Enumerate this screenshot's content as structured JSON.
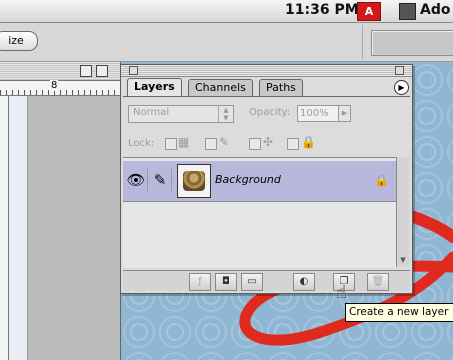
{
  "menubar": {
    "clock": "11:36 PM",
    "app_name": "Ado"
  },
  "options_bar": {
    "size_button": "ize"
  },
  "document": {
    "ruler_mark": "8"
  },
  "layers_panel": {
    "tabs": [
      "Layers",
      "Channels",
      "Paths"
    ],
    "blend_mode": "Normal",
    "opacity_label": "Opacity:",
    "opacity_value": "100%",
    "lock_label": "Lock:",
    "layers": [
      {
        "name": "Background",
        "visible": true,
        "locked": true
      }
    ]
  },
  "tooltip": "Create a new layer",
  "colors": {
    "panel_bg": "#dcdcdc",
    "selected_layer": "#b7b8dc",
    "canvas_blue": "#8fb6d2",
    "stroke_red": "#e02a1e",
    "tooltip_bg": "#ffffe1"
  },
  "icons": [
    "eye-icon",
    "brush-icon",
    "lock-icon",
    "menu-arrow-icon",
    "layer-style-icon",
    "layer-mask-icon",
    "layer-set-icon",
    "adjustment-layer-icon",
    "new-layer-icon",
    "trash-icon",
    "hand-cursor-icon"
  ]
}
